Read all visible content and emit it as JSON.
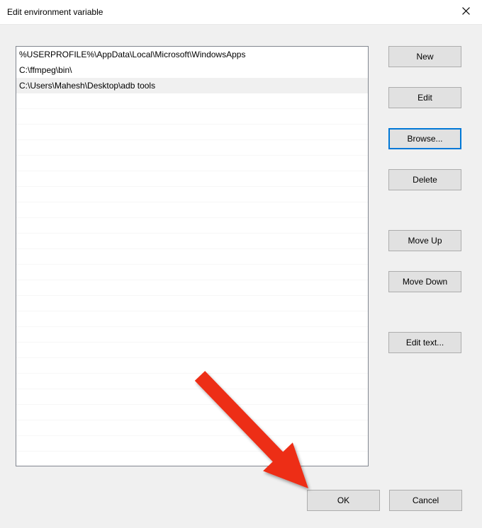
{
  "titlebar": {
    "title": "Edit environment variable"
  },
  "paths": [
    "%USERPROFILE%\\AppData\\Local\\Microsoft\\WindowsApps",
    "C:\\ffmpeg\\bin\\",
    "C:\\Users\\Mahesh\\Desktop\\adb tools"
  ],
  "selected_index": 2,
  "buttons": {
    "new": "New",
    "edit": "Edit",
    "browse": "Browse...",
    "delete": "Delete",
    "move_up": "Move Up",
    "move_down": "Move Down",
    "edit_text": "Edit text...",
    "ok": "OK",
    "cancel": "Cancel"
  },
  "colors": {
    "arrow": "#ed2d19"
  }
}
